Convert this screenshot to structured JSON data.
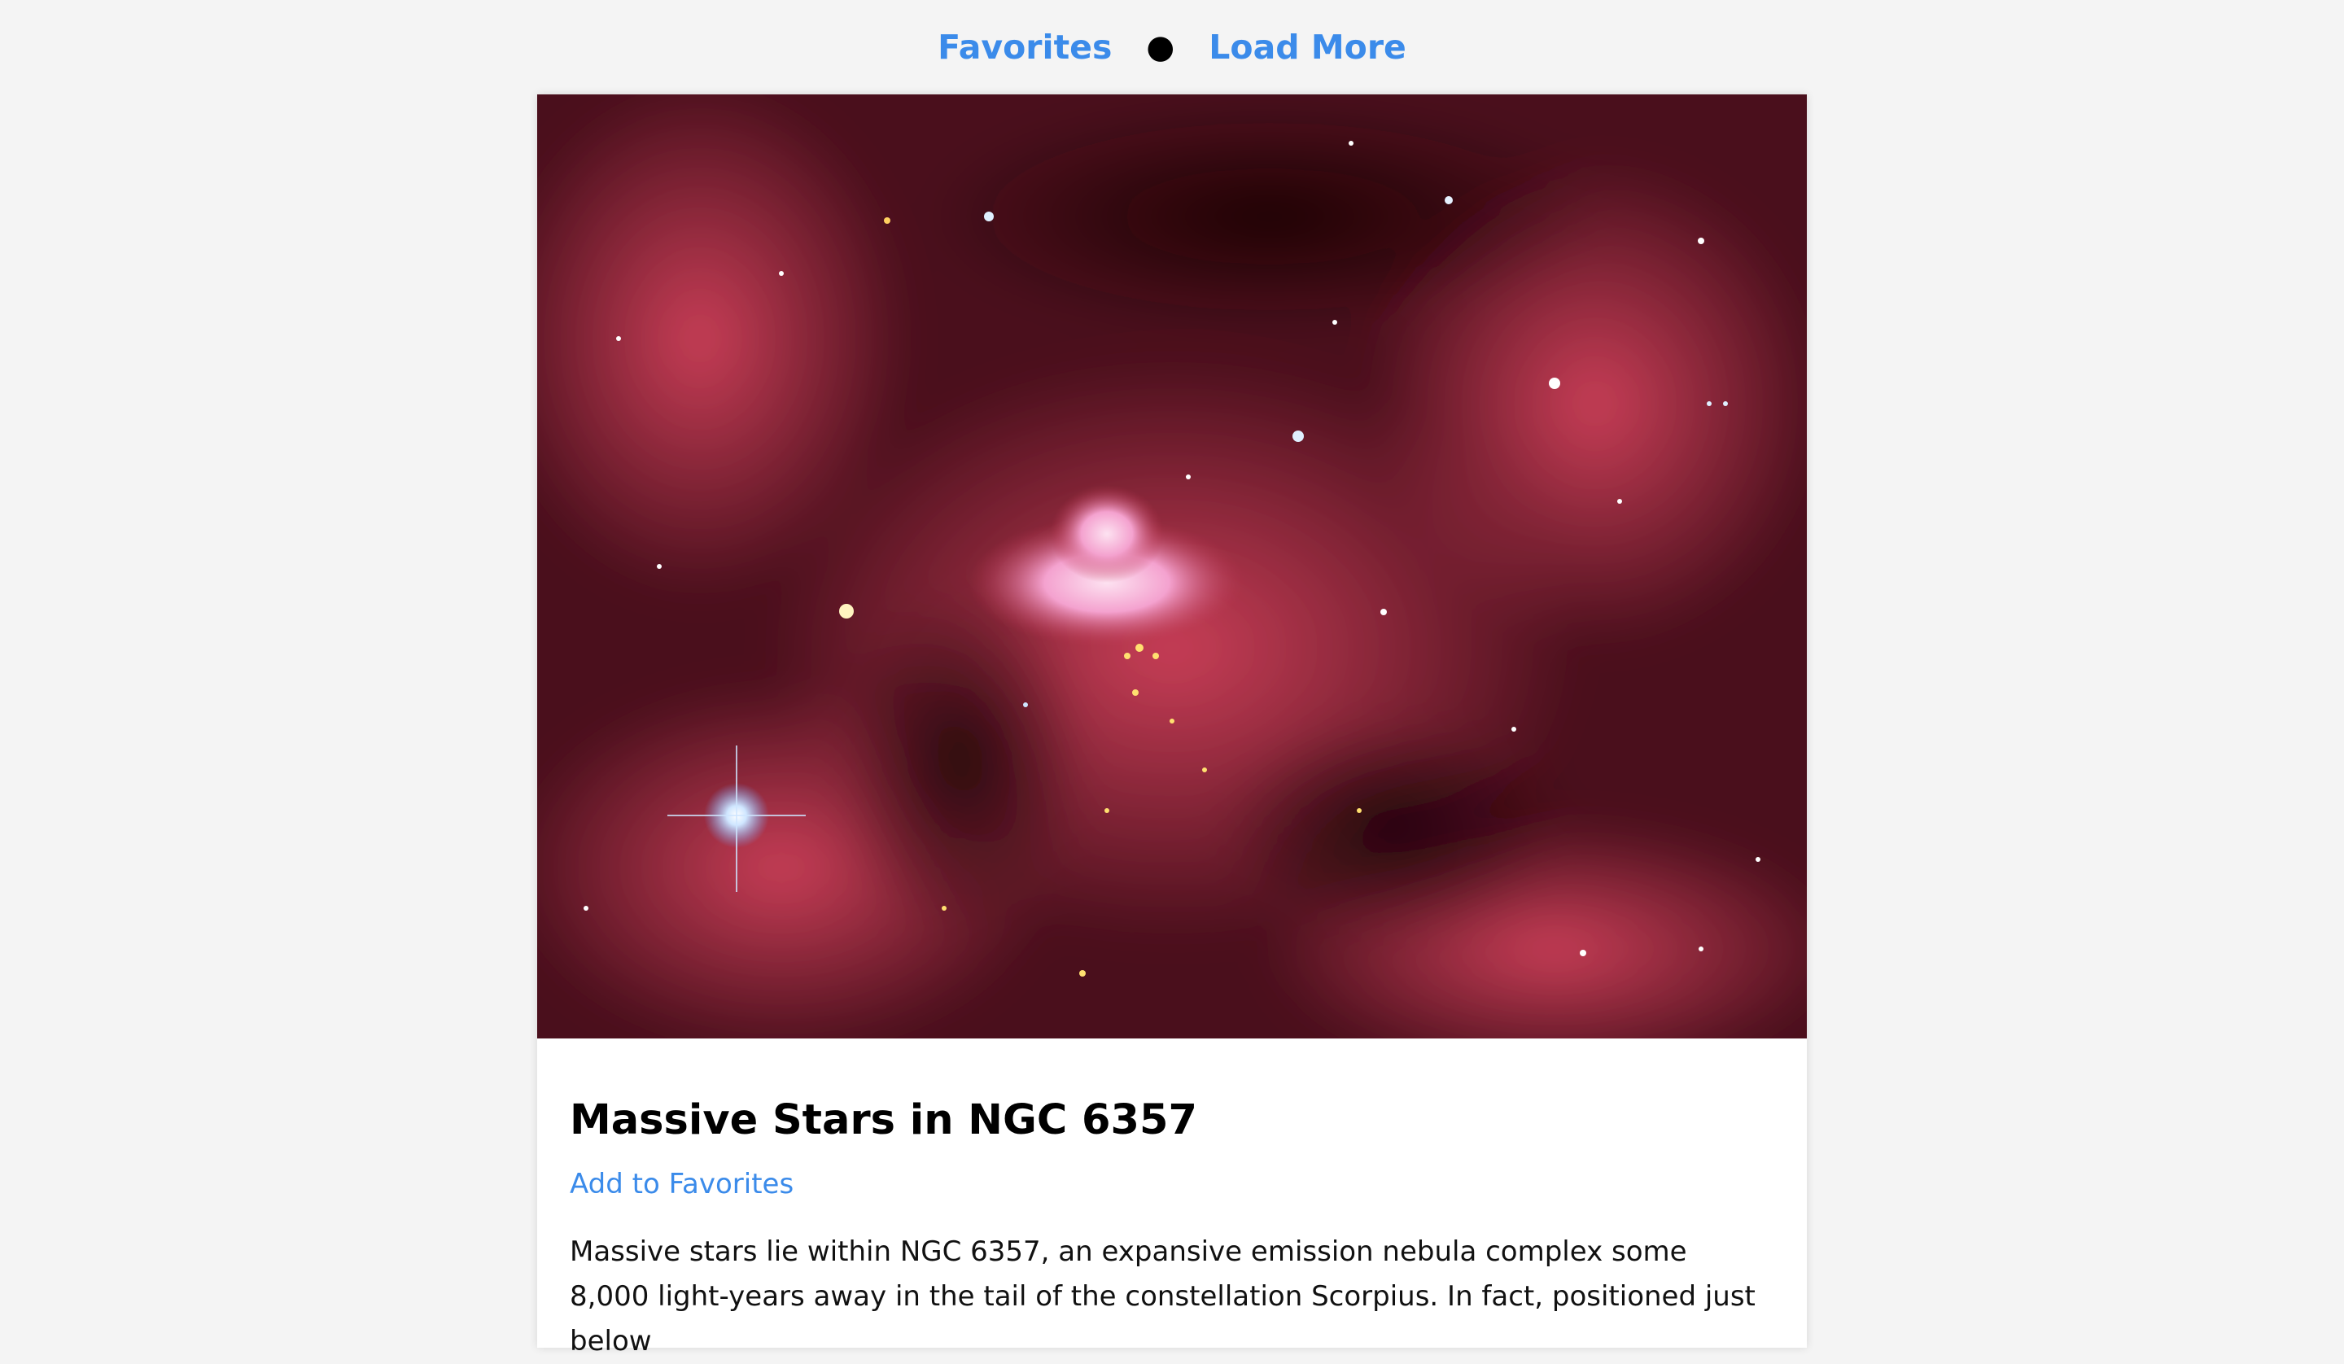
{
  "nav": {
    "favorites_label": "Favorites",
    "separator": "●",
    "load_more_label": "Load More"
  },
  "card": {
    "image": {
      "subject": "red emission nebula star field",
      "colors": {
        "nebula": "#b8324a",
        "dark": "#2a0a10",
        "core": "#f4b6d8"
      }
    },
    "title": "Massive Stars in NGC 6357",
    "favorite_action": "Add to Favorites",
    "description": "Massive stars lie within NGC 6357, an expansive emission nebula complex some 8,000 light-years away in the tail of the constellation Scorpius. In fact, positioned just below"
  },
  "colors": {
    "link": "#3b8bea",
    "page_bg": "#f4f4f4",
    "card_bg": "#ffffff"
  }
}
